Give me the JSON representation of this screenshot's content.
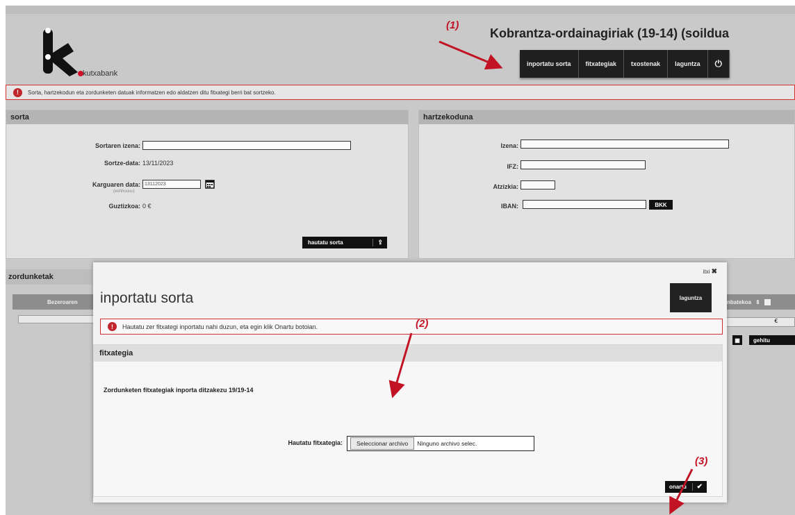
{
  "app": {
    "title": "Kobrantza-ordainagiriak (19-14) (soildua",
    "logo_text": "kutxabank"
  },
  "nav": {
    "items": [
      "inportatu sorta",
      "fitxategiak",
      "txostenak",
      "laguntza"
    ],
    "power_icon": "power-icon"
  },
  "info_bar": {
    "text": "Sorta, hartzekodun eta zordunketen datuak informatzen edo aldatzen ditu fitxategi berri bat sortzeko."
  },
  "sorta": {
    "heading": "sorta",
    "name_label": "Sortaren izena:",
    "name_value": "",
    "creation_label": "Sortze-data:",
    "creation_value": "13/11/2023",
    "charge_label": "Karguaren data:",
    "charge_hint": "(eehhuuuu)",
    "charge_value": "13112023",
    "total_label": "Guztizkoa:",
    "total_value": "0 €",
    "select_button": "hautatu sorta"
  },
  "hartzekoduna": {
    "heading": "hartzekoduna",
    "izena_label": "Izena:",
    "ifz_label": "IFZ:",
    "atzizkia_label": "Atzizkia:",
    "iban_label": "IBAN:",
    "bkk_button": "BKK"
  },
  "zordunketak": {
    "heading": "zordunketak",
    "col_left": "Bezeroaren",
    "col_right": "nbatekoa",
    "euro": "€",
    "add_button": "gehitu"
  },
  "modal": {
    "close_label": "itxi",
    "title": "inportatu sorta",
    "help_button": "laguntza",
    "warning": "Hautatu zer fitxategi inportatu nahi duzun, eta egin klik Onartu botoian.",
    "section_heading": "fitxategia",
    "description": "Zordunketen fitxategiak inporta ditzakezu 19/19-14",
    "file_label": "Hautatu fitxategia:",
    "file_button": "Seleccionar archivo",
    "file_name": "Ninguno archivo selec.",
    "accept_button": "onartu"
  },
  "annotations": {
    "one": "(1)",
    "two": "(2)",
    "three": "(3)"
  },
  "colors": {
    "annotation_red": "#c21325",
    "warning_red": "#d23030",
    "nav_dark": "#1f1f1f"
  }
}
